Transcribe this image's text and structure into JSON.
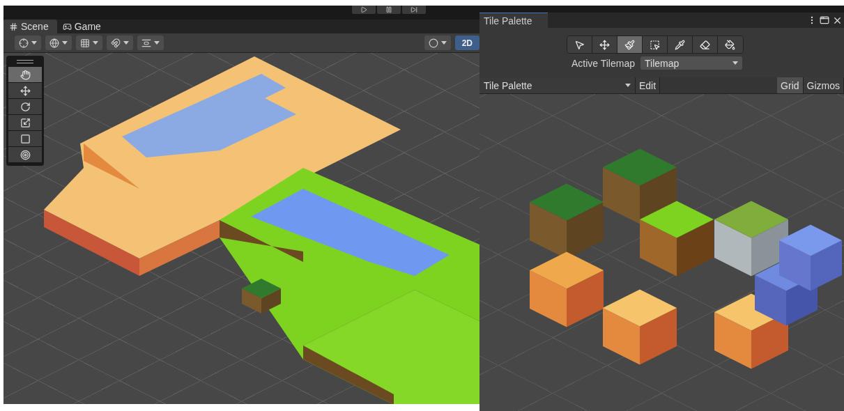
{
  "playbar": [
    {
      "kind": "play"
    },
    {
      "kind": "pause"
    },
    {
      "kind": "step"
    }
  ],
  "scene_window": {
    "tabs": [
      {
        "label": "Scene",
        "kind": "scene",
        "selected": true
      },
      {
        "label": "Game",
        "kind": "game",
        "selected": false
      }
    ],
    "toolbar": [
      {
        "kind": "gizmo-transform"
      },
      {
        "kind": "globe"
      },
      {
        "kind": "grid"
      },
      {
        "kind": "snap"
      },
      {
        "kind": "increment"
      }
    ],
    "shading": {
      "kind": "shading"
    },
    "mode_button": {
      "label": "2D",
      "on": true
    },
    "tools": [
      {
        "kind": "hand",
        "selected": true
      },
      {
        "kind": "move",
        "selected": false
      },
      {
        "kind": "rotate",
        "selected": false
      },
      {
        "kind": "scale",
        "selected": false
      },
      {
        "kind": "rect",
        "selected": false
      },
      {
        "kind": "transform",
        "selected": false
      }
    ]
  },
  "tile_palette": {
    "title": "Tile Palette",
    "tools": [
      {
        "kind": "select",
        "selected": false
      },
      {
        "kind": "move",
        "selected": false
      },
      {
        "kind": "paint",
        "selected": true
      },
      {
        "kind": "box",
        "selected": false
      },
      {
        "kind": "pick",
        "selected": false
      },
      {
        "kind": "erase",
        "selected": false
      },
      {
        "kind": "fill",
        "selected": false
      }
    ],
    "active_tilemap": {
      "label": "Active Tilemap",
      "value": "Tilemap"
    },
    "palette_select": "Tile Palette",
    "edit_button": "Edit",
    "toggles": [
      {
        "label": "Grid",
        "selected": true
      },
      {
        "label": "Gizmos",
        "selected": false
      }
    ]
  }
}
